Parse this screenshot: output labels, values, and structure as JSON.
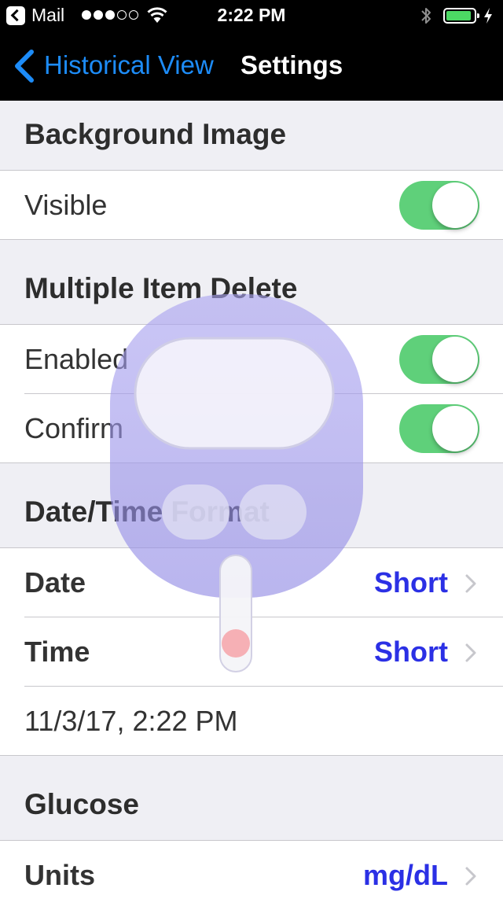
{
  "status_bar": {
    "back_app": "Mail",
    "signal_bars_filled": 3,
    "signal_bars_total": 5,
    "time": "2:22 PM",
    "battery_level": 0.9,
    "battery_color": "#4cd964"
  },
  "nav": {
    "back_label": "Historical View",
    "title": "Settings",
    "accent_color": "#1d8cf8"
  },
  "sections": {
    "background_image": {
      "header": "Background Image",
      "visible": {
        "label": "Visible",
        "on": true
      }
    },
    "multiple_item_delete": {
      "header": "Multiple Item Delete",
      "enabled": {
        "label": "Enabled",
        "on": true
      },
      "confirm": {
        "label": "Confirm",
        "on": true
      }
    },
    "date_time_format": {
      "header": "Date/Time Format",
      "date": {
        "label": "Date",
        "value": "Short"
      },
      "time": {
        "label": "Time",
        "value": "Short"
      },
      "preview": "11/3/17, 2:22 PM"
    },
    "glucose": {
      "header": "Glucose",
      "units": {
        "label": "Units",
        "value": "mg/dL"
      }
    }
  },
  "colors": {
    "toggle_on": "#5fd07a",
    "detail_value": "#2b30e5",
    "group_background": "#efeff4"
  },
  "background_graphic": "glucose-meter-watermark"
}
